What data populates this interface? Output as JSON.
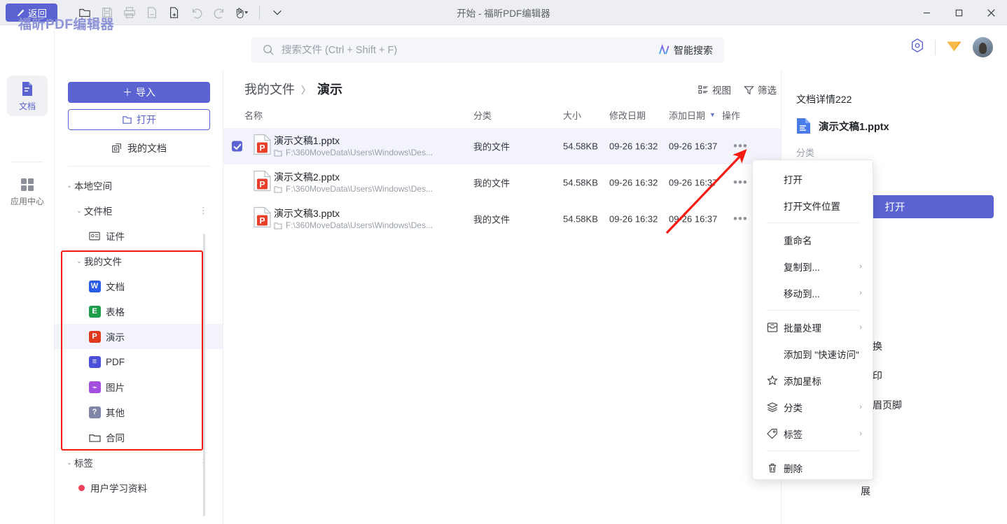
{
  "titlebar": {
    "back_label": "返回",
    "window_title": "开始 - 福昕PDF编辑器",
    "tools": [
      {
        "name": "open-folder-icon",
        "disabled": false
      },
      {
        "name": "save-icon",
        "disabled": true
      },
      {
        "name": "print-icon",
        "disabled": true
      },
      {
        "name": "copy-page-icon",
        "disabled": true
      },
      {
        "name": "new-page-icon",
        "disabled": false
      },
      {
        "name": "undo-icon",
        "disabled": true
      },
      {
        "name": "redo-icon",
        "disabled": true
      },
      {
        "name": "hand-tool-icon",
        "disabled": false
      }
    ],
    "minimize": "—",
    "maximize": "□",
    "close": "✕"
  },
  "brand": "福昕PDF编辑器",
  "rail": {
    "items": [
      {
        "label": "文档",
        "icon": "document-icon",
        "active": true
      },
      {
        "label": "应用中心",
        "icon": "apps-grid-icon",
        "active": false
      }
    ]
  },
  "sidebar": {
    "import_label": "导入",
    "open_label": "打开",
    "my_documents_label": "我的文档",
    "tree": [
      {
        "label": "本地空间",
        "level": 0,
        "caret": "⌄",
        "icon": "",
        "dots": false,
        "selected": false
      },
      {
        "label": "文件柜",
        "level": 1,
        "caret": "⌄",
        "icon": "",
        "dots": true,
        "selected": false
      },
      {
        "label": "证件",
        "level": 2,
        "caret": "",
        "icon": "id-card-icon",
        "dots": false,
        "selected": false
      },
      {
        "label": "我的文件",
        "level": 1,
        "caret": "⌄",
        "icon": "",
        "dots": true,
        "selected": false
      },
      {
        "label": "文档",
        "level": 2,
        "caret": "",
        "icon": "word-icon",
        "dots": false,
        "selected": false
      },
      {
        "label": "表格",
        "level": 2,
        "caret": "",
        "icon": "excel-icon",
        "dots": false,
        "selected": false
      },
      {
        "label": "演示",
        "level": 2,
        "caret": "",
        "icon": "ppt-icon",
        "dots": false,
        "selected": true
      },
      {
        "label": "PDF",
        "level": 2,
        "caret": "",
        "icon": "pdf-icon",
        "dots": false,
        "selected": false
      },
      {
        "label": "图片",
        "level": 2,
        "caret": "",
        "icon": "image-icon",
        "dots": false,
        "selected": false
      },
      {
        "label": "其他",
        "level": 2,
        "caret": "",
        "icon": "other-icon",
        "dots": false,
        "selected": false
      },
      {
        "label": "合同",
        "level": 2,
        "caret": "",
        "icon": "folder-icon",
        "dots": false,
        "selected": false
      },
      {
        "label": "标签",
        "level": 0,
        "caret": "⌄",
        "icon": "",
        "dots": true,
        "selected": false
      },
      {
        "label": "用户学习资料",
        "level": 1,
        "caret": "",
        "icon": "tag-dot",
        "dots": false,
        "selected": false
      }
    ]
  },
  "search": {
    "placeholder": "搜索文件 (Ctrl + Shift + F)",
    "value": "",
    "ai_label": "智能搜索"
  },
  "header_right": {
    "settings_icon": "hex-gear-icon",
    "vip_icon": "vip-diamond-icon",
    "avatar": "user-avatar"
  },
  "breadcrumb": {
    "parent": "我的文件",
    "separator": "〉",
    "current": "演示"
  },
  "view_actions": [
    {
      "label": "视图",
      "icon": "view-layout-icon"
    },
    {
      "label": "筛选",
      "icon": "filter-icon"
    }
  ],
  "table": {
    "columns": [
      "名称",
      "分类",
      "大小",
      "修改日期",
      "添加日期",
      "操作"
    ],
    "sorted_column": "添加日期",
    "sort_indicator": "▼",
    "rows": [
      {
        "name": "演示文稿1.pptx",
        "path": "F:\\360MoveData\\Users\\Windows\\Des...",
        "category": "我的文件",
        "size": "54.58KB",
        "modified": "09-26 16:32",
        "added": "09-26 16:37",
        "selected": true,
        "checked": true
      },
      {
        "name": "演示文稿2.pptx",
        "path": "F:\\360MoveData\\Users\\Windows\\Des...",
        "category": "我的文件",
        "size": "54.58KB",
        "modified": "09-26 16:32",
        "added": "09-26 16:37",
        "selected": false,
        "checked": false
      },
      {
        "name": "演示文稿3.pptx",
        "path": "F:\\360MoveData\\Users\\Windows\\Des...",
        "category": "我的文件",
        "size": "54.58KB",
        "modified": "09-26 16:32",
        "added": "09-26 16:37",
        "selected": false,
        "checked": false
      }
    ]
  },
  "details": {
    "title": "文档详情222",
    "file_name": "演示文稿1.pptx",
    "category_label": "分类",
    "open_label": "打开",
    "partial_label": "展",
    "quick_actions": [
      {
        "label": "批量替换",
        "icon": "batch-replace-icon"
      },
      {
        "label": "批量水印",
        "icon": "batch-watermark-icon"
      },
      {
        "label": "设置页眉页脚",
        "icon": "header-footer-icon"
      }
    ]
  },
  "context_menu": {
    "items": [
      {
        "label": "打开",
        "icon": "",
        "submenu": false,
        "divider_after": false
      },
      {
        "label": "打开文件位置",
        "icon": "",
        "submenu": false,
        "divider_after": true
      },
      {
        "label": "重命名",
        "icon": "",
        "submenu": false,
        "divider_after": false
      },
      {
        "label": "复制到...",
        "icon": "",
        "submenu": true,
        "divider_after": false
      },
      {
        "label": "移动到...",
        "icon": "",
        "submenu": true,
        "divider_after": true
      },
      {
        "label": "批量处理",
        "icon": "batch-icon",
        "submenu": true,
        "divider_after": false
      },
      {
        "label": "添加到 \"快速访问\"",
        "icon": "",
        "submenu": false,
        "divider_after": false
      },
      {
        "label": "添加星标",
        "icon": "star-icon",
        "submenu": false,
        "divider_after": false
      },
      {
        "label": "分类",
        "icon": "layers-icon",
        "submenu": true,
        "divider_after": false
      },
      {
        "label": "标签",
        "icon": "tag-icon",
        "submenu": true,
        "divider_after": true
      },
      {
        "label": "删除",
        "icon": "trash-icon",
        "submenu": false,
        "divider_after": false
      }
    ]
  },
  "colors": {
    "accent": "#5b63d3",
    "annotation_red": "#f51b13",
    "selected_row": "#f3f4fb",
    "titlebar": "#eceef1"
  }
}
